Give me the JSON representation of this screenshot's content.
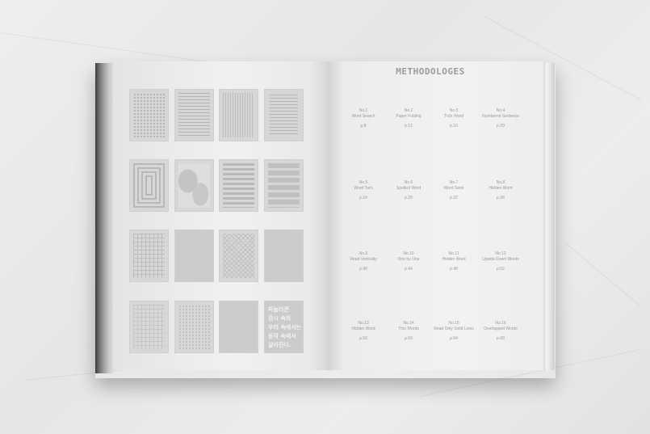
{
  "page_title": "METHODOLOGES",
  "thumbnail_text": {
    "t10": "",
    "t12": "",
    "t15": "",
    "t16": "파놉티콘\n감시 속의\n우리 속에서는\n동작 속에서\n살아진다."
  },
  "toc": [
    {
      "num": "No.1",
      "title": "Word Search",
      "page": "p.8"
    },
    {
      "num": "No.2",
      "title": "Paper Folding",
      "page": "p.12"
    },
    {
      "num": "No.3",
      "title": "Trick Word",
      "page": "p.16"
    },
    {
      "num": "No.4",
      "title": "Numbered Sentence",
      "page": "p.20"
    },
    {
      "num": "No.5",
      "title": "Word Turn",
      "page": "p.24"
    },
    {
      "num": "No.6",
      "title": "Spotted Word",
      "page": "p.28"
    },
    {
      "num": "No.7",
      "title": "Word Seek",
      "page": "p.32"
    },
    {
      "num": "No.8",
      "title": "Hidden Word",
      "page": "p.36"
    },
    {
      "num": "No.9",
      "title": "Read Vertically",
      "page": "p.40"
    },
    {
      "num": "No.10",
      "title": "One by One",
      "page": "p.44"
    },
    {
      "num": "No.11",
      "title": "Hidden Word",
      "page": "p.48"
    },
    {
      "num": "No.12",
      "title": "Upside-Down Words",
      "page": "p.52"
    },
    {
      "num": "No.13",
      "title": "Hidden Word",
      "page": "p.56"
    },
    {
      "num": "No.14",
      "title": "Thin Words",
      "page": "p.60"
    },
    {
      "num": "No.15",
      "title": "Read Only Solid Lines",
      "page": "p.64"
    },
    {
      "num": "No.16",
      "title": "Overlapped Words",
      "page": "p.68"
    }
  ],
  "colors": {
    "page_text": "#9a9a9a",
    "spine_dark": "#3a3a3a"
  }
}
